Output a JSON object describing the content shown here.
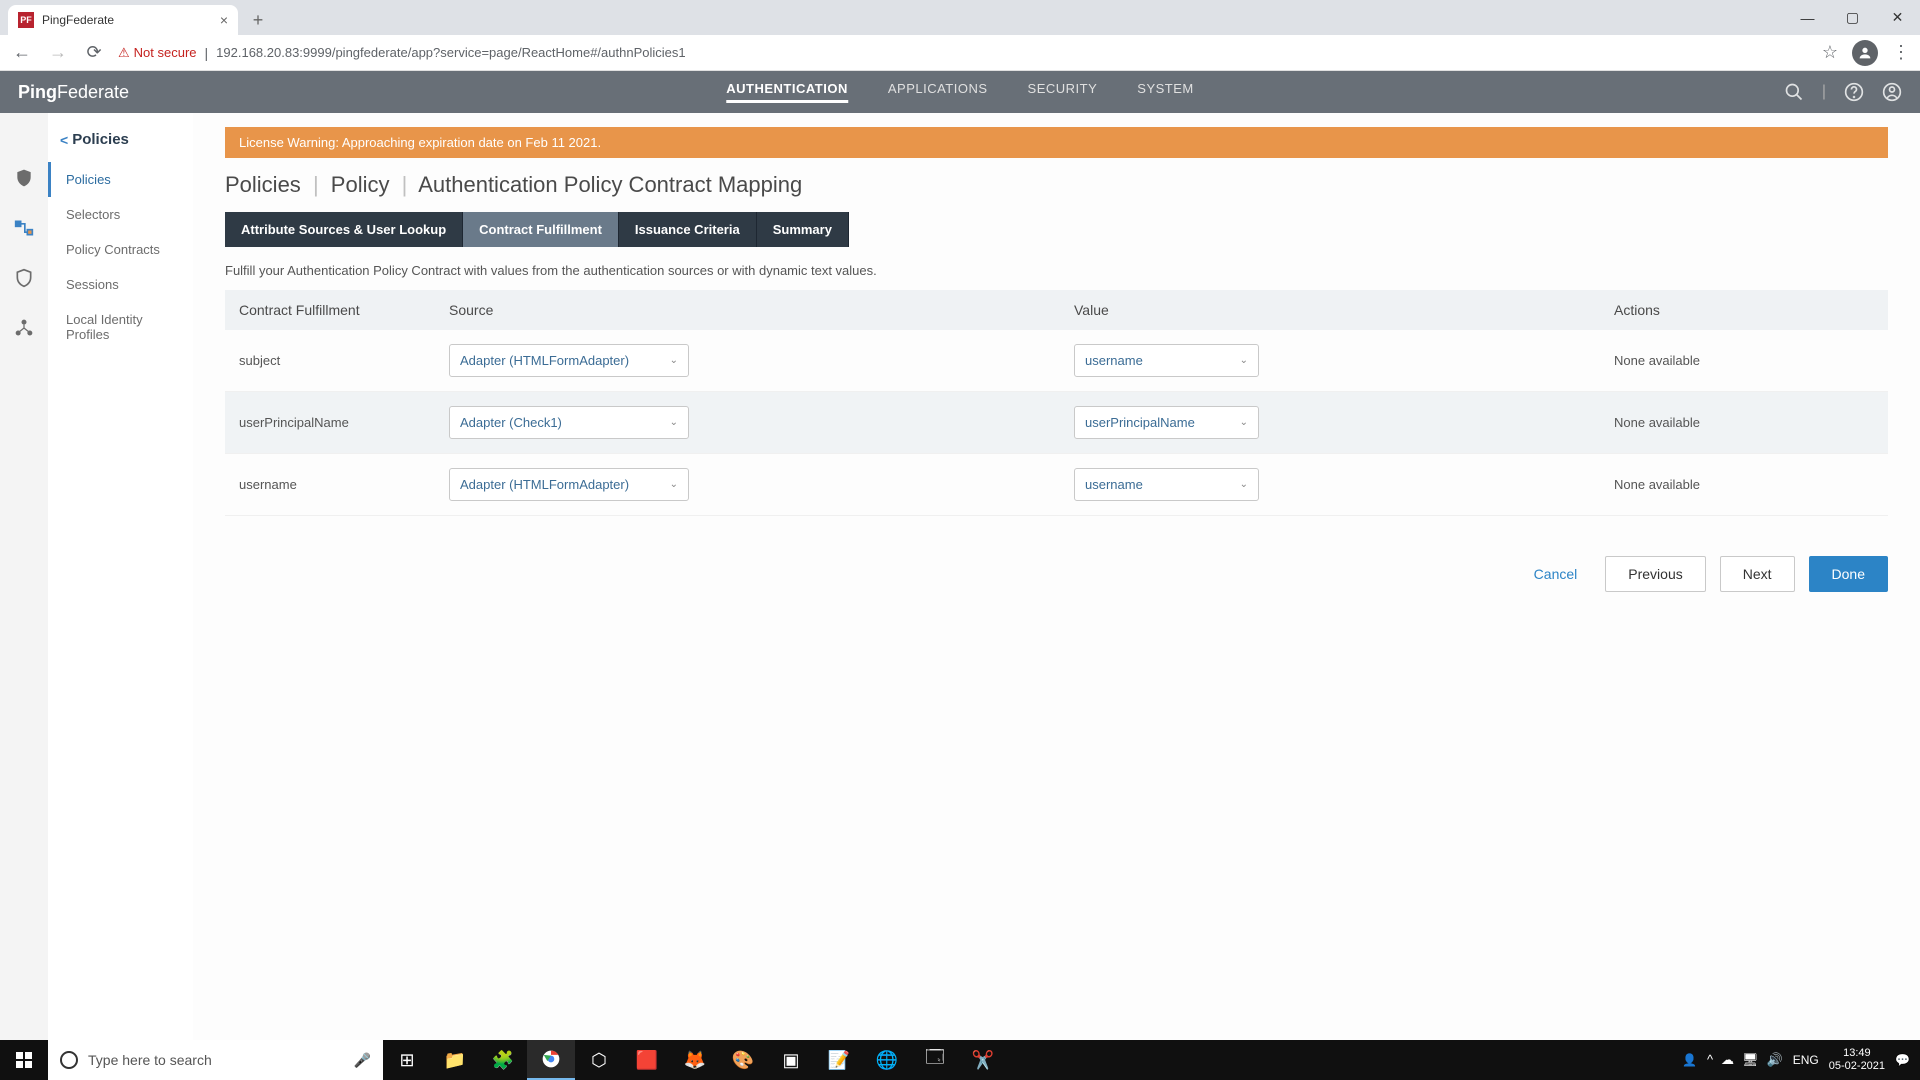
{
  "browser": {
    "tab_title": "PingFederate",
    "not_secure": "Not secure",
    "url": "192.168.20.83:9999/pingfederate/app?service=page/ReactHome#/authnPolicies1"
  },
  "header": {
    "logo_part1": "Ping",
    "logo_part2": "Federate",
    "nav": {
      "authentication": "AUTHENTICATION",
      "applications": "APPLICATIONS",
      "security": "SECURITY",
      "system": "SYSTEM"
    }
  },
  "sidebar": {
    "header": "Policies",
    "items": [
      "Policies",
      "Selectors",
      "Policy Contracts",
      "Sessions",
      "Local Identity Profiles"
    ]
  },
  "content": {
    "warning": "License Warning: Approaching expiration date on Feb 11 2021.",
    "breadcrumb": [
      "Policies",
      "Policy",
      "Authentication Policy Contract Mapping"
    ],
    "tabs": [
      "Attribute Sources & User Lookup",
      "Contract Fulfillment",
      "Issuance Criteria",
      "Summary"
    ],
    "active_tab": "Contract Fulfillment",
    "description": "Fulfill your Authentication Policy Contract with values from the authentication sources or with dynamic text values.",
    "table": {
      "headers": {
        "contract": "Contract Fulfillment",
        "source": "Source",
        "value": "Value",
        "actions": "Actions"
      },
      "rows": [
        {
          "contract": "subject",
          "source": "Adapter (HTMLFormAdapter)",
          "value": "username",
          "actions": "None available"
        },
        {
          "contract": "userPrincipalName",
          "source": "Adapter (Check1)",
          "value": "userPrincipalName",
          "actions": "None available"
        },
        {
          "contract": "username",
          "source": "Adapter (HTMLFormAdapter)",
          "value": "username",
          "actions": "None available"
        }
      ]
    },
    "buttons": {
      "cancel": "Cancel",
      "previous": "Previous",
      "next": "Next",
      "done": "Done"
    }
  },
  "taskbar": {
    "search_placeholder": "Type here to search",
    "lang": "ENG",
    "time": "13:49",
    "date": "05-02-2021"
  }
}
